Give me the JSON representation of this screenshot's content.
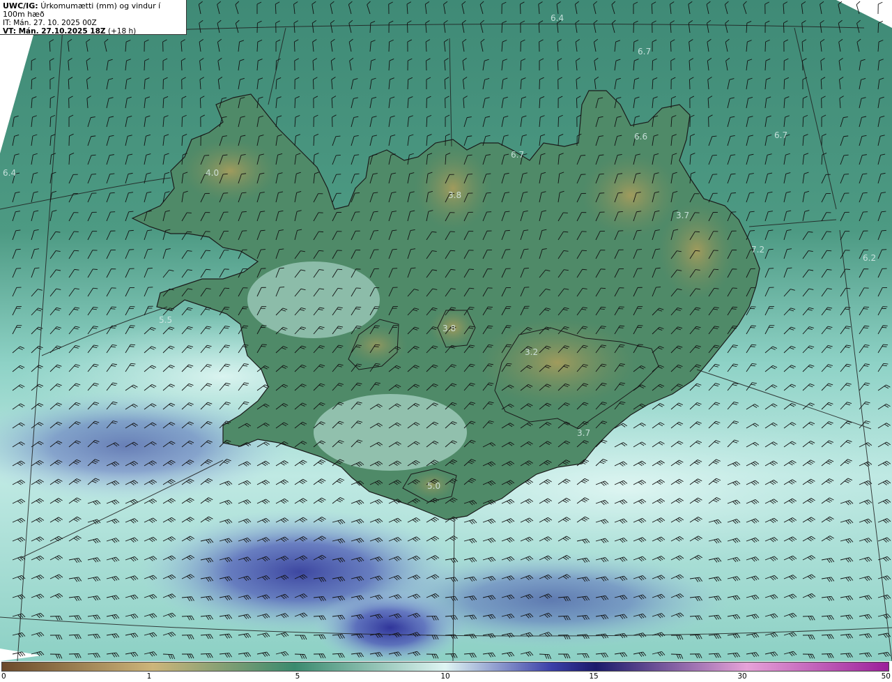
{
  "header": {
    "model": "UWC/IG:",
    "field": "Úrkomumætti (mm) og vindur í 100m hæð",
    "init_time": "IT: Mán. 27. 10. 2025 00Z",
    "valid_label": "VT: Mán. 27.10.2025 18Z",
    "lead": "(+18 h)"
  },
  "map_labels": [
    {
      "name": "label-6-4-north",
      "value": "6.4"
    },
    {
      "name": "label-6-7-ne-top",
      "value": "6.7"
    },
    {
      "name": "label-6-7-east",
      "value": "6.7"
    },
    {
      "name": "label-6-6",
      "value": "6.6"
    },
    {
      "name": "label-6-7-mid",
      "value": "6.7"
    },
    {
      "name": "label-4-0",
      "value": "4.0"
    },
    {
      "name": "label-3-8-north",
      "value": "3.8"
    },
    {
      "name": "label-3-7-east",
      "value": "3.7"
    },
    {
      "name": "label-7-2",
      "value": "7.2"
    },
    {
      "name": "label-6-2",
      "value": "6.2"
    },
    {
      "name": "label-5-5",
      "value": "5.5"
    },
    {
      "name": "label-3-8-central",
      "value": "3.8"
    },
    {
      "name": "label-3-2",
      "value": "3.2"
    },
    {
      "name": "label-3-7-south",
      "value": "3.7"
    },
    {
      "name": "label-5-0",
      "value": "5.0"
    },
    {
      "name": "label-6-4-west",
      "value": "6.4"
    }
  ],
  "colorbar": {
    "ticks": [
      "0",
      "1",
      "5",
      "10",
      "15",
      "30",
      "50"
    ],
    "colors": {
      "low": "#6b4a2a",
      "sand": "#cdb57a",
      "green": "#3a8a6e",
      "pale": "#dff5f3",
      "blue": "#3b3fa8",
      "navy": "#1b1a6b",
      "pink": "#e6a2d8",
      "purple": "#9b1f9a"
    }
  },
  "colors": {
    "sea_green": "#3f8e77",
    "land_green": "#4f8a68",
    "highland": "#9c9a5a",
    "pale_sea": "#bde7e2",
    "rain_blue": "#5963c0",
    "coast": "#1a1a1a",
    "grid_line": "#1f1f1f",
    "barb": "#111111"
  }
}
